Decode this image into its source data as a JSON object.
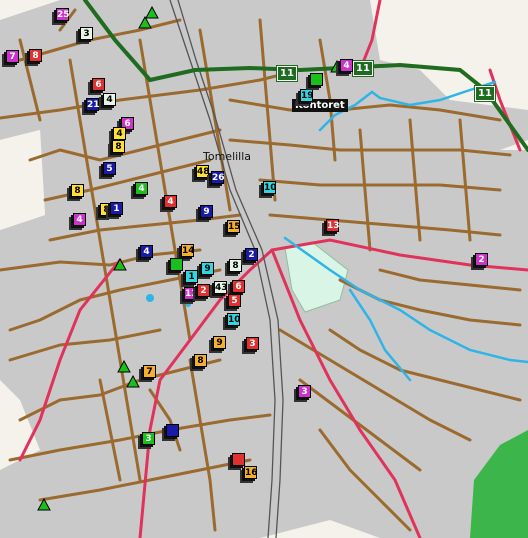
{
  "map": {
    "place_label": "Tomelilla",
    "office_label": "Kontoret",
    "route_number": "11",
    "colors": {
      "built_area": "#c9c9c9",
      "open_land": "#f4f2ea",
      "street": "#9b6a2e",
      "main_road": "#e0325a",
      "highway": "#1f6b1f",
      "river": "#2fb4e8",
      "park": "#d8f5e6",
      "forest": "#3cb54a",
      "railway": "#555555"
    }
  },
  "markers": [
    {
      "label": "25",
      "color": "#cc33cc",
      "shape": "square"
    },
    {
      "label": "",
      "color": "#1bbf1b",
      "shape": "triangle"
    },
    {
      "label": "3",
      "color": "#e6f5e6",
      "shape": "square"
    },
    {
      "label": "",
      "color": "#1bbf1b",
      "shape": "triangle"
    },
    {
      "label": "7",
      "color": "#cc33cc",
      "shape": "square"
    },
    {
      "label": "8",
      "color": "#e03030",
      "shape": "square"
    },
    {
      "label": "6",
      "color": "#e03030",
      "shape": "square"
    },
    {
      "label": "21",
      "color": "#1a1aa8",
      "shape": "square"
    },
    {
      "label": "4",
      "color": "#e6f5e6",
      "shape": "square"
    },
    {
      "label": "6",
      "color": "#cc33cc",
      "shape": "square"
    },
    {
      "label": "4",
      "color": "#ffe033",
      "shape": "square"
    },
    {
      "label": "8",
      "color": "#ffe033",
      "shape": "square"
    },
    {
      "label": "5",
      "color": "#1a1aa8",
      "shape": "square"
    },
    {
      "label": "8",
      "color": "#ffe033",
      "shape": "square"
    },
    {
      "label": "4",
      "color": "#1bbf1b",
      "shape": "square"
    },
    {
      "label": "8",
      "color": "#ffe033",
      "shape": "square"
    },
    {
      "label": "4",
      "color": "#cc33cc",
      "shape": "square"
    },
    {
      "label": "1",
      "color": "#1a1aa8",
      "shape": "square"
    },
    {
      "label": "4",
      "color": "#e03030",
      "shape": "square"
    },
    {
      "label": "48",
      "color": "#ffe033",
      "shape": "square"
    },
    {
      "label": "26",
      "color": "#1a1aa8",
      "shape": "square"
    },
    {
      "label": "9",
      "color": "#1a1aa8",
      "shape": "square"
    },
    {
      "label": "10",
      "color": "#33d6e0",
      "shape": "square"
    },
    {
      "label": "15",
      "color": "#f5b030",
      "shape": "square"
    },
    {
      "label": "13",
      "color": "#e03030",
      "shape": "square"
    },
    {
      "label": "4",
      "color": "#1a1aa8",
      "shape": "square"
    },
    {
      "label": "",
      "color": "#1bbf1b",
      "shape": "triangle"
    },
    {
      "label": "14",
      "color": "#f5b030",
      "shape": "square"
    },
    {
      "label": "",
      "color": "#1bbf1b",
      "shape": "square"
    },
    {
      "label": "9",
      "color": "#33d6e0",
      "shape": "square"
    },
    {
      "label": "8",
      "color": "#e6f5e6",
      "shape": "square"
    },
    {
      "label": "2",
      "color": "#1a1aa8",
      "shape": "square"
    },
    {
      "label": "1",
      "color": "#33d6e0",
      "shape": "square"
    },
    {
      "label": "13",
      "color": "#cc33cc",
      "shape": "square"
    },
    {
      "label": "2",
      "color": "#e03030",
      "shape": "square"
    },
    {
      "label": "43",
      "color": "#e6f5e6",
      "shape": "square"
    },
    {
      "label": "6",
      "color": "#e03030",
      "shape": "square"
    },
    {
      "label": "5",
      "color": "#e03030",
      "shape": "square"
    },
    {
      "label": "10",
      "color": "#33d6e0",
      "shape": "square"
    },
    {
      "label": "3",
      "color": "#e03030",
      "shape": "square"
    },
    {
      "label": "9",
      "color": "#f5b030",
      "shape": "square"
    },
    {
      "label": "8",
      "color": "#f5b030",
      "shape": "square"
    },
    {
      "label": "7",
      "color": "#f5b030",
      "shape": "square"
    },
    {
      "label": "",
      "color": "#1bbf1b",
      "shape": "triangle"
    },
    {
      "label": "",
      "color": "#1bbf1b",
      "shape": "triangle"
    },
    {
      "label": "3",
      "color": "#cc33cc",
      "shape": "square"
    },
    {
      "label": "2",
      "color": "#cc33cc",
      "shape": "square"
    },
    {
      "label": "",
      "color": "#1bbf1b",
      "shape": "triangle"
    },
    {
      "label": "3",
      "color": "#1bbf1b",
      "shape": "square"
    },
    {
      "label": "",
      "color": "#1a1aa8",
      "shape": "square"
    },
    {
      "label": "",
      "color": "#e03030",
      "shape": "square"
    },
    {
      "label": "16",
      "color": "#f5b030",
      "shape": "square"
    },
    {
      "label": "",
      "color": "#1bbf1b",
      "shape": "triangle"
    },
    {
      "label": "19",
      "color": "#33d6e0",
      "shape": "square"
    },
    {
      "label": "4",
      "color": "#cc33cc",
      "shape": "square"
    },
    {
      "label": "",
      "color": "#1bbf1b",
      "shape": "square"
    }
  ]
}
